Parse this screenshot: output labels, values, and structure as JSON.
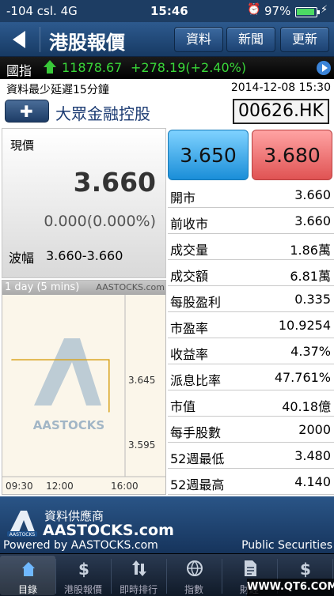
{
  "status_bar": {
    "carrier": "-104 csl.  4G",
    "time": "15:46",
    "battery": "97%",
    "icons": [
      "alarm-icon",
      "battery-icon",
      "charging-icon"
    ]
  },
  "nav": {
    "title": "港股報價",
    "buttons": {
      "data": "資料",
      "news": "新聞",
      "refresh": "更新"
    }
  },
  "index": {
    "label": "國指",
    "value": "11878.67",
    "change": "+278.19(+2.40%)",
    "color_up": "#39d839"
  },
  "info": {
    "delay_notice": "資料最少延遲15分鐘",
    "timestamp": "2014-12-08 15:30"
  },
  "stock": {
    "add_label": "✚",
    "name": "大眾金融控股",
    "code": "00626.HK"
  },
  "quote": {
    "label": "現價",
    "price": "3.660",
    "change": "0.000(0.000%)",
    "range_label": "波幅",
    "range": "3.660-3.660",
    "bid": "3.650",
    "ask": "3.680"
  },
  "stats": [
    {
      "key": "開市",
      "value": "3.660"
    },
    {
      "key": "前收市",
      "value": "3.660"
    },
    {
      "key": "成交量",
      "value": "1.86萬"
    },
    {
      "key": "成交額",
      "value": "6.81萬"
    },
    {
      "key": "每股盈利",
      "value": "0.335"
    },
    {
      "key": "市盈率",
      "value": "10.9254"
    },
    {
      "key": "收益率",
      "value": "4.37%"
    },
    {
      "key": "派息比率",
      "value": "47.761%"
    },
    {
      "key": "市值",
      "value": "40.18億"
    },
    {
      "key": "每手股數",
      "value": "2000"
    },
    {
      "key": "52週最低",
      "value": "3.480"
    },
    {
      "key": "52週最高",
      "value": "4.140"
    }
  ],
  "chart_data": {
    "type": "line",
    "period": "1 day (5 mins)",
    "source": "AASTOCKS.com",
    "watermark": "AASTOCKS",
    "x_ticks": [
      "09:30",
      "12:00",
      "16:00"
    ],
    "y_ticks": [
      "3.645",
      "3.595"
    ],
    "ylim": [
      3.57,
      3.71
    ],
    "series": [
      {
        "values": [
          {
            "t": "09:30",
            "y": 3.66
          },
          {
            "t": "15:30",
            "y": 3.66
          },
          {
            "t": "15:30",
            "y": 3.62
          }
        ]
      }
    ],
    "line_color": "#d9a21a"
  },
  "footer": {
    "provider_label": "資料供應商",
    "provider_name": "AASTOCKS.com",
    "powered_by": "Powered by AASTOCKS.com",
    "broker": "Public Securities"
  },
  "tabs": [
    {
      "label": "目錄",
      "icon": "home-icon",
      "active": true
    },
    {
      "label": "港股報價",
      "icon": "dollar-icon",
      "active": false
    },
    {
      "label": "即時排行",
      "icon": "sort-icon",
      "active": false
    },
    {
      "label": "指數",
      "icon": "globe-icon",
      "active": false
    },
    {
      "label": "財經",
      "icon": "document-icon",
      "active": false
    },
    {
      "label": "",
      "icon": "dollar-icon",
      "active": false
    }
  ],
  "watermark_text": "WWW.QT6.COM"
}
